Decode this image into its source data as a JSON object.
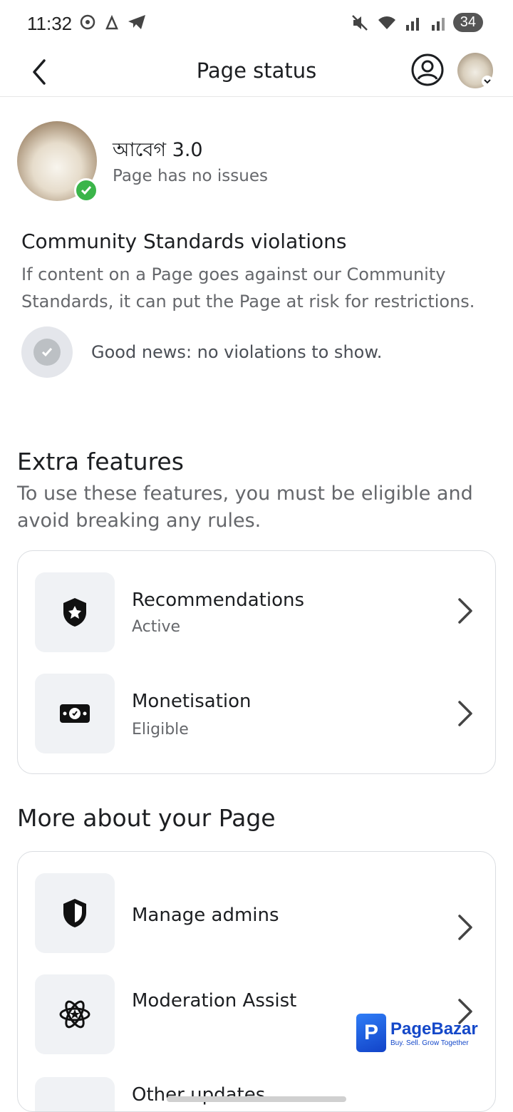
{
  "status_bar": {
    "time": "11:32",
    "battery": "34"
  },
  "header": {
    "title": "Page status"
  },
  "page": {
    "name": "আবেগ 3.0",
    "issues_text": "Page has no issues"
  },
  "community_standards": {
    "title": "Community Standards violations",
    "description": "If content on a Page goes against our Community Standards, it can put the Page at risk for restrictions.",
    "status_text": "Good news: no violations to show."
  },
  "extra_features": {
    "title": "Extra features",
    "description": "To use these features, you must be eligible and avoid breaking any rules.",
    "items": [
      {
        "label": "Recommendations",
        "status": "Active",
        "icon": "shield-star-icon"
      },
      {
        "label": "Monetisation",
        "status": "Eligible",
        "icon": "money-icon"
      }
    ]
  },
  "more_about": {
    "title": "More about your Page",
    "items": [
      {
        "label": "Manage admins",
        "icon": "shield-icon"
      },
      {
        "label": "Moderation Assist",
        "icon": "atom-star-icon"
      },
      {
        "label": "Other updates",
        "icon": "updates-icon"
      }
    ]
  },
  "brand": {
    "name": "PageBazar",
    "tagline": "Buy. Sell. Grow Together",
    "logo_letter": "P"
  }
}
